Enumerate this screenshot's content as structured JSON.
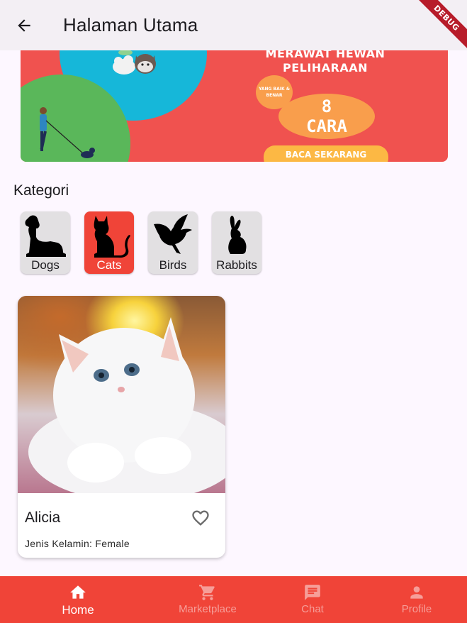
{
  "appbar": {
    "title": "Halaman Utama",
    "back_icon": "arrow-back-icon",
    "debug_label": "DEBUG"
  },
  "banner": {
    "headline_line1": "MERAWAT HEWAN",
    "headline_line2": "PELIHARAAN",
    "badge_text": "YANG BAIK & BENAR",
    "count": "8",
    "count_word": "CARA",
    "cta": "BACA SEKARANG",
    "colors": {
      "background": "#f0524f",
      "blue": "#16b7d9",
      "green": "#5ab75a",
      "accent": "#f99e4c",
      "cta": "#fcb844"
    }
  },
  "categories": {
    "title": "Kategori",
    "items": [
      {
        "label": "Dogs",
        "icon": "dog-silhouette-icon",
        "selected": false
      },
      {
        "label": "Cats",
        "icon": "cat-silhouette-icon",
        "selected": true
      },
      {
        "label": "Birds",
        "icon": "bird-silhouette-icon",
        "selected": false
      },
      {
        "label": "Rabbits",
        "icon": "rabbit-silhouette-icon",
        "selected": false
      }
    ]
  },
  "pets": [
    {
      "name": "Alicia",
      "gender_text": "Jenis Kelamin: Female",
      "favorite_icon": "heart-outline-icon",
      "favorited": false
    }
  ],
  "bottom_nav": {
    "items": [
      {
        "label": "Home",
        "icon": "home-icon",
        "active": true
      },
      {
        "label": "Marketplace",
        "icon": "shopping-cart-icon",
        "active": false
      },
      {
        "label": "Chat",
        "icon": "chat-icon",
        "active": false
      },
      {
        "label": "Profile",
        "icon": "person-icon",
        "active": false
      }
    ],
    "colors": {
      "background": "#f04438",
      "active_text": "#ffffff",
      "inactive_text": "#f69e99"
    }
  }
}
